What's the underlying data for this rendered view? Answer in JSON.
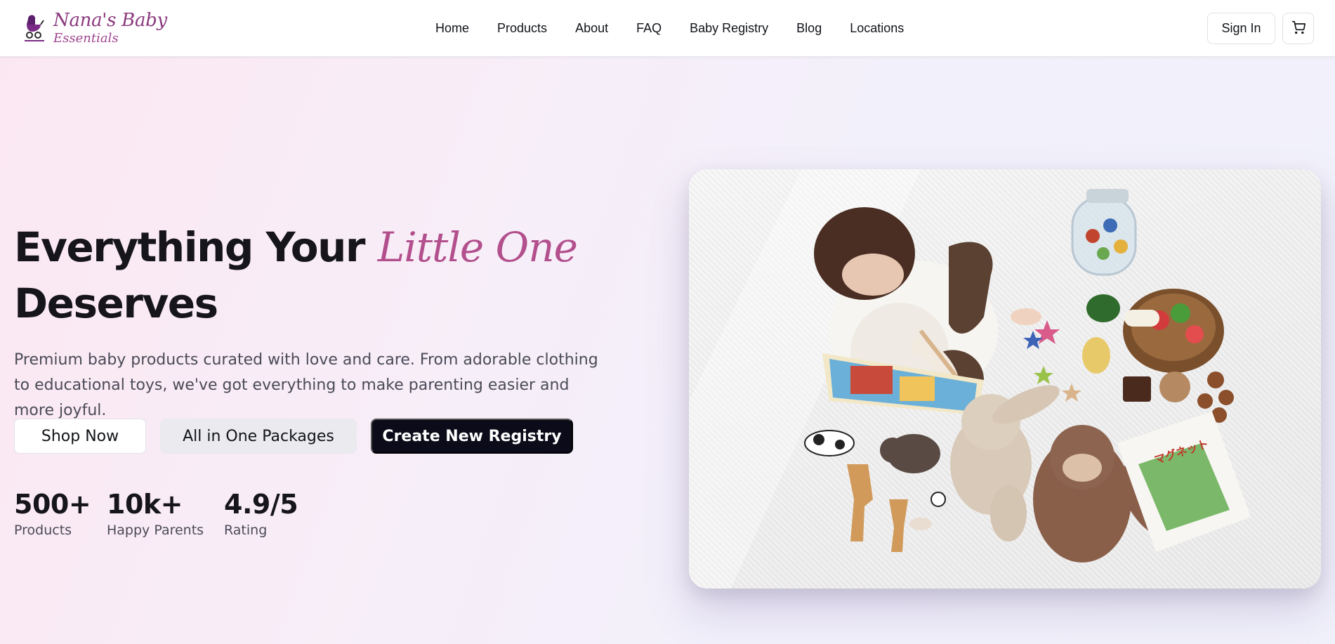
{
  "brand": {
    "name_line1": "Nana's Baby",
    "name_line2": "Essentials"
  },
  "nav": {
    "items": [
      "Home",
      "Products",
      "About",
      "FAQ",
      "Baby Registry",
      "Blog",
      "Locations"
    ]
  },
  "header_actions": {
    "sign_in": "Sign In",
    "cart_icon": "cart-icon"
  },
  "hero": {
    "title_part1": "Everything Your ",
    "title_accent": "Little One",
    "title_part2": "Deserves",
    "subtitle": "Premium baby products curated with love and care. From adorable clothing to educational toys, we've got everything to make parenting easier and more joyful.",
    "buttons": {
      "shop_now": "Shop Now",
      "packages": "All in One Packages",
      "registry": "Create New Registry"
    },
    "stats": [
      {
        "value": "500+",
        "label": "Products"
      },
      {
        "value": "10k+",
        "label": "Happy Parents"
      },
      {
        "value": "4.9/5",
        "label": "Rating"
      }
    ],
    "image_alt_icon": "baby-with-toys-photo"
  },
  "colors": {
    "brand_purple": "#8b3a7e",
    "accent_pink": "#b24f8c",
    "cta_dark": "#0b0b19"
  }
}
